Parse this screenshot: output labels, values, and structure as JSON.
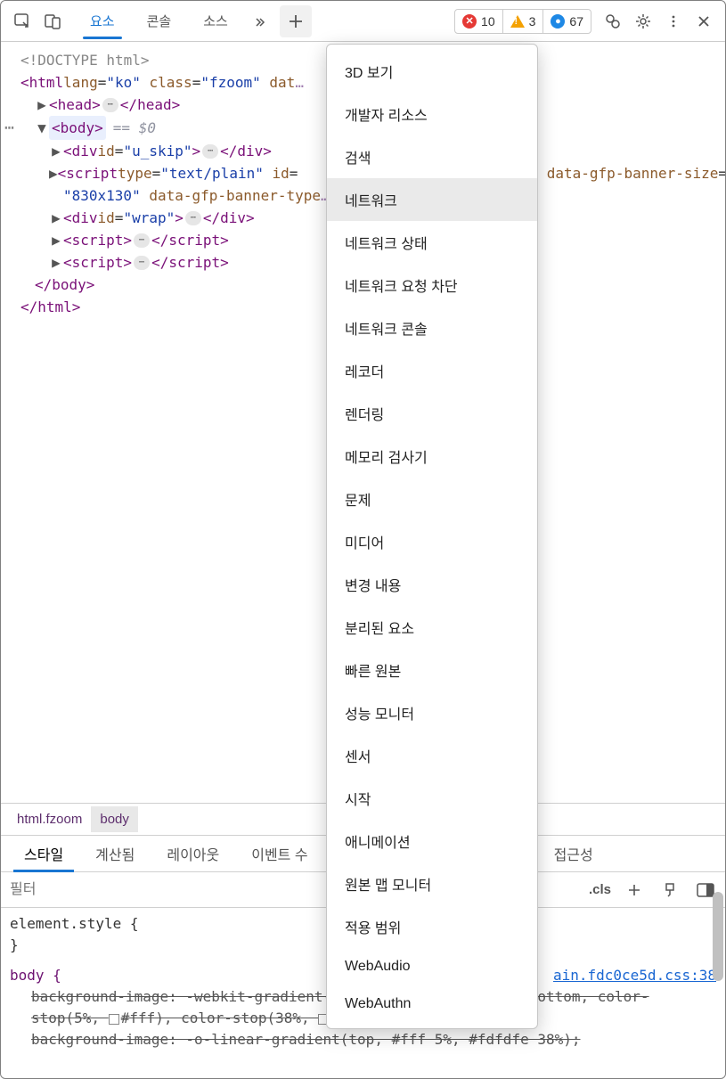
{
  "toolbar": {
    "tabs": [
      "요소",
      "콘솔",
      "소스"
    ],
    "badges": {
      "errors": "10",
      "warnings": "3",
      "info": "67"
    }
  },
  "dom": {
    "doctype": "<!DOCTYPE html>",
    "html_open": "<html lang=\"ko\" class=\"fzoom\" dat",
    "head_open": "<head>",
    "head_close": "</head>",
    "body_open": "<body>",
    "body_sel_eq": "== $0",
    "div_uskip_open": "<div id=\"u_skip\">",
    "div_uskip_close": "</div>",
    "script1_a": "<script type=\"text/plain\" id=",
    "script1_b": "data-gfp-banner-size=",
    "script1_c": "\"830x130\" data-gfp-banner-type",
    "div_wrap_open": "<div id=\"wrap\">",
    "div_wrap_close": "</div>",
    "script_open": "<script>",
    "script_close": "</script>",
    "body_close": "</body>",
    "html_close": "</html>"
  },
  "breadcrumb": {
    "a": "html.fzoom",
    "b": "body"
  },
  "subtabs": {
    "styles": "스타일",
    "computed": "계산됨",
    "layout": "레이아웃",
    "event": "이벤트 수",
    "a11y": "접근성"
  },
  "filter": {
    "placeholder": "필터",
    "hov": ".cls"
  },
  "styles_pane": {
    "elstyle": "element.style {",
    "brace_close": "}",
    "body_sel": "body {",
    "link": "ain.fdc0ce5d.css:38",
    "rule1": "background-image: -webkit-gradient(linear, left top, left bottom, color-stop(5%, ▢ #fff), color-stop(38%, ▢ #fdfdfe));",
    "rule2": "background-image: -o-linear-gradient(top, #fff 5%, #fdfdfe 38%);"
  },
  "dropdown": {
    "items": [
      "3D 보기",
      "개발자 리소스",
      "검색",
      "네트워크",
      "네트워크 상태",
      "네트워크 요청 차단",
      "네트워크 콘솔",
      "레코더",
      "렌더링",
      "메모리 검사기",
      "문제",
      "미디어",
      "변경 내용",
      "분리된 요소",
      "빠른 원본",
      "성능 모니터",
      "센서",
      "시작",
      "애니메이션",
      "원본 맵 모니터",
      "적용 범위",
      "WebAudio",
      "WebAuthn"
    ],
    "highlight_index": 3
  }
}
